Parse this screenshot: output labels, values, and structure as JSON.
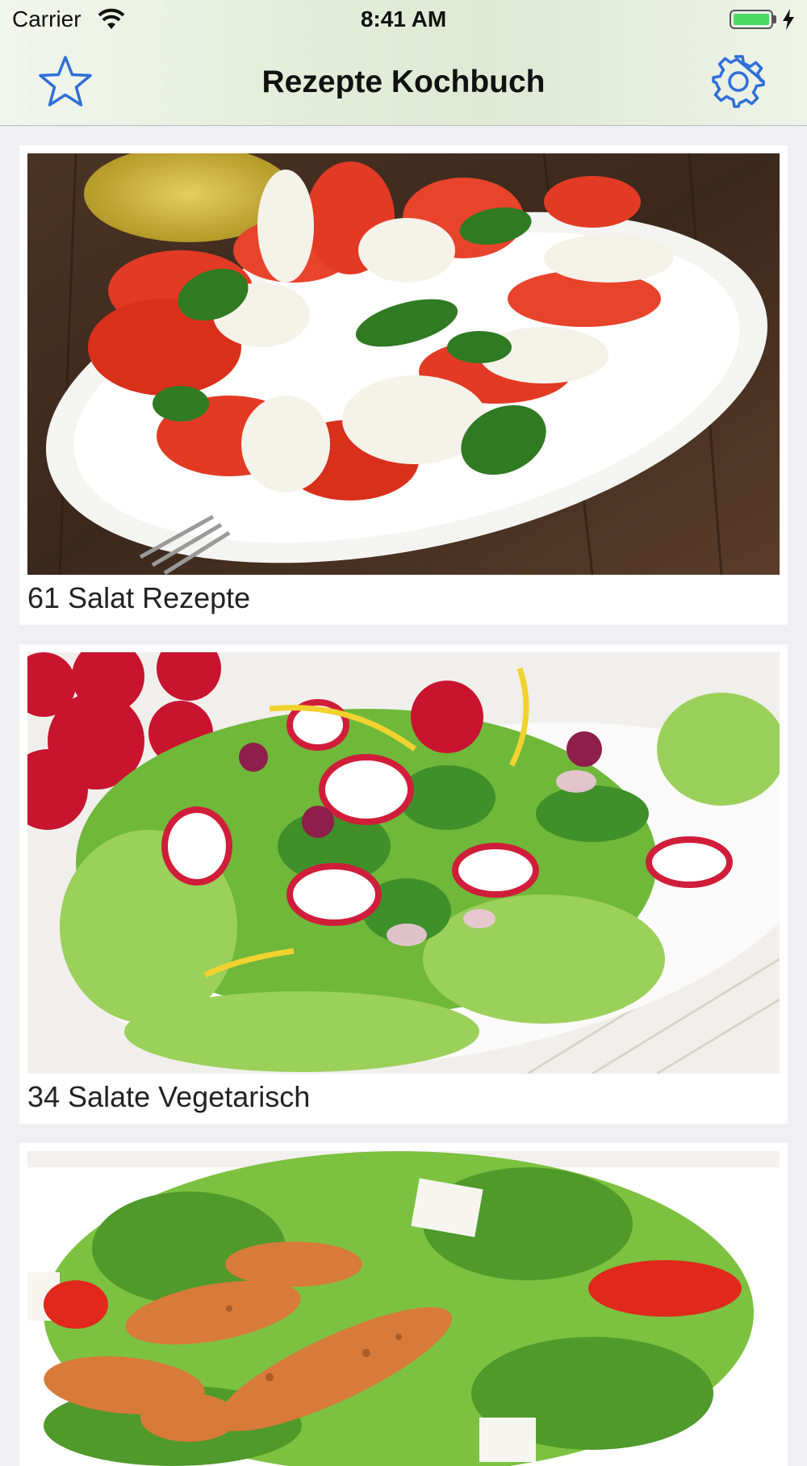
{
  "status_bar": {
    "carrier": "Carrier",
    "time": "8:41 AM"
  },
  "nav": {
    "title": "Rezepte Kochbuch",
    "left_icon": "star-icon",
    "right_icon": "gear-icon"
  },
  "accent_color": "#2f6fd8",
  "cards": [
    {
      "label": "61 Salat Rezepte",
      "image": "caprese salad with tomato, mozzarella and basil on white plate"
    },
    {
      "label": "34 Salate Vegetarisch",
      "image": "green leaf salad with radishes and dressing"
    },
    {
      "label": "",
      "image": "salad with grilled chicken strips, feta and tomato"
    }
  ]
}
